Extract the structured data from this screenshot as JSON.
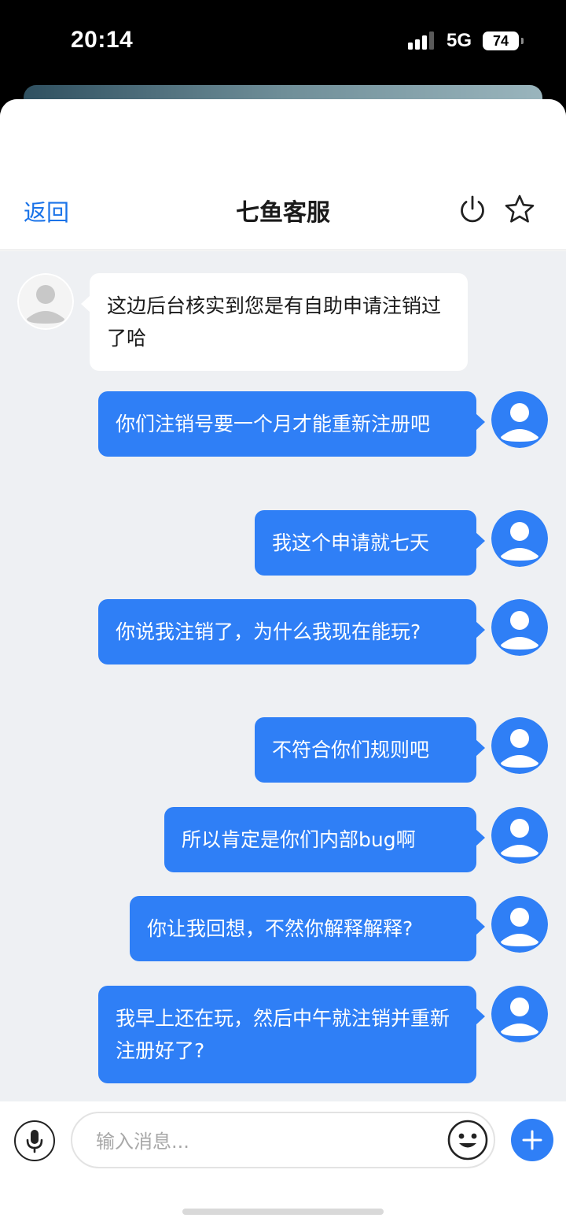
{
  "status_bar": {
    "time": "20:14",
    "network": "5G",
    "battery": "74"
  },
  "header": {
    "back_label": "返回",
    "title": "七鱼客服",
    "icons": [
      "power-icon",
      "star-icon"
    ]
  },
  "messages": [
    {
      "side": "in",
      "text": "这边后台核实到您是有自助申请注销过了哈"
    },
    {
      "side": "out",
      "text": "你们注销号要一个月才能重新注册吧"
    },
    {
      "side": "out",
      "text": "我这个申请就七天"
    },
    {
      "side": "out",
      "text": "你说我注销了，为什么我现在能玩?"
    },
    {
      "side": "out",
      "text": "不符合你们规则吧"
    },
    {
      "side": "out",
      "text": "所以肯定是你们内部bug啊"
    },
    {
      "side": "out",
      "text": "你让我回想，不然你解释解释?"
    },
    {
      "side": "out",
      "text": "我早上还在玩，然后中午就注销并重新注册好了?"
    }
  ],
  "input": {
    "placeholder": "输入消息..."
  },
  "colors": {
    "accent": "#2f7ff6",
    "link": "#1a73e8",
    "chat_background": "#eef0f3"
  }
}
